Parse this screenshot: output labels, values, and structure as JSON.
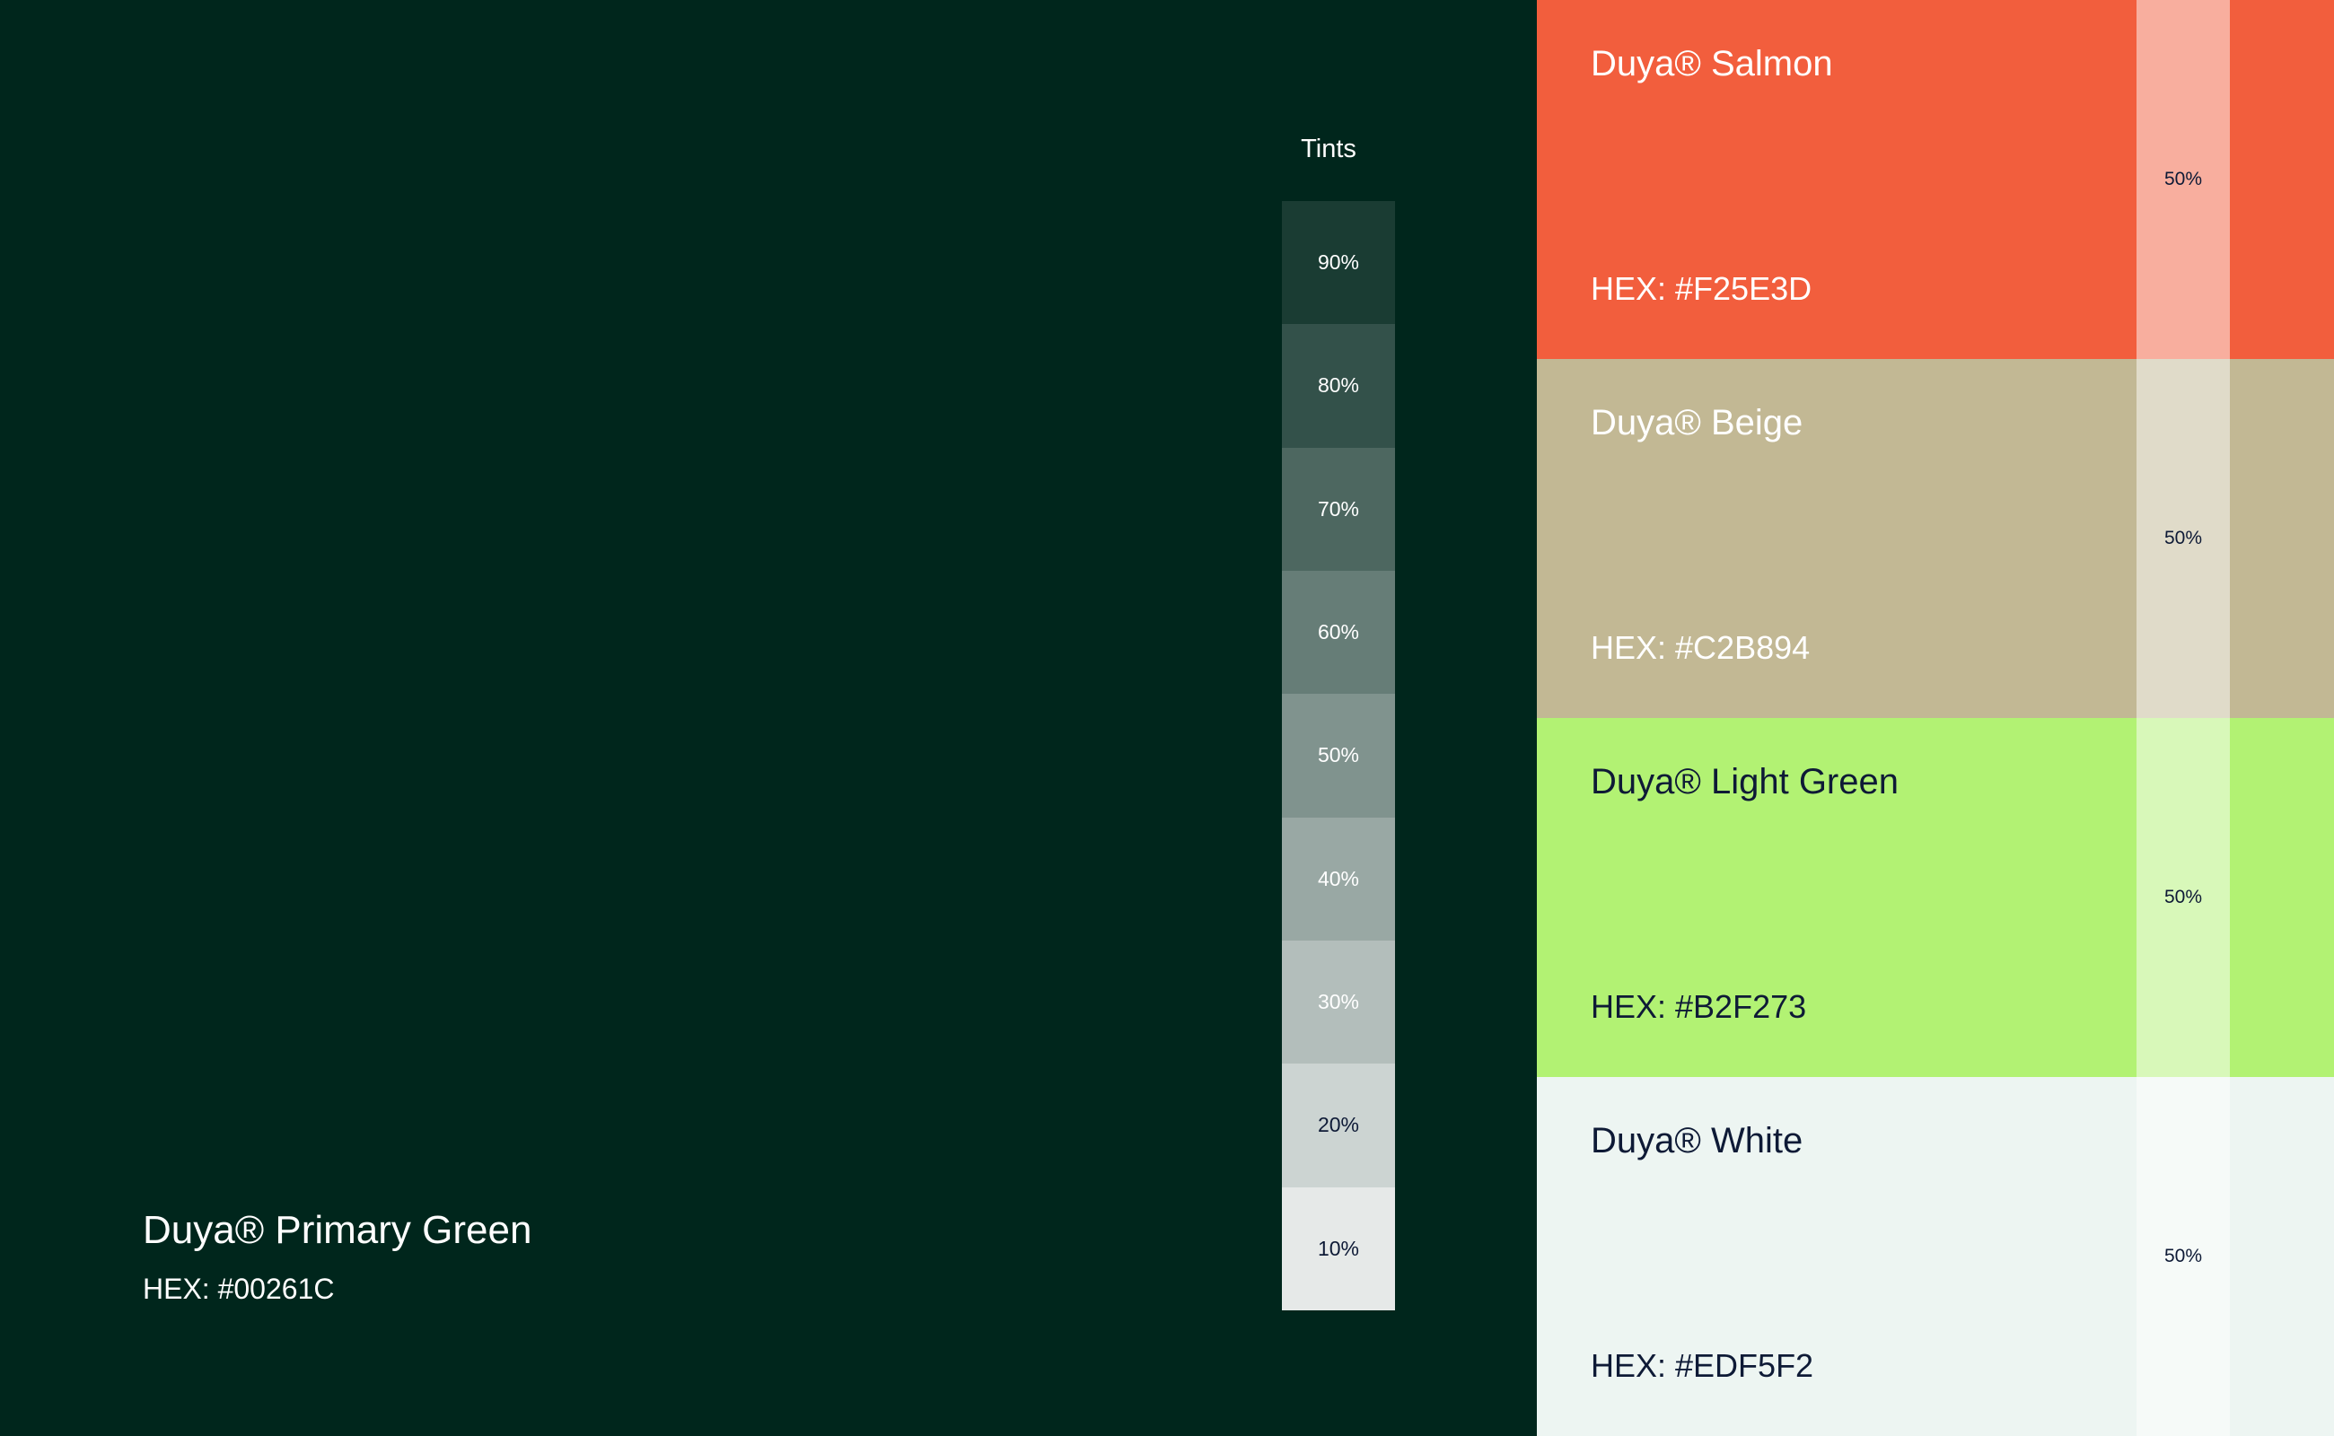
{
  "primary": {
    "name": "Duya® Primary Green",
    "hex_label": "HEX: #00261C",
    "color": "#00261C"
  },
  "tints": {
    "label": "Tints",
    "swatches": [
      {
        "label": "90%",
        "color": "#1A3C33",
        "text_color": "#FFFFFF"
      },
      {
        "label": "80%",
        "color": "#33514A",
        "text_color": "#FFFFFF"
      },
      {
        "label": "70%",
        "color": "#4D6760",
        "text_color": "#FFFFFF"
      },
      {
        "label": "60%",
        "color": "#667D77",
        "text_color": "#FFFFFF"
      },
      {
        "label": "50%",
        "color": "#80938E",
        "text_color": "#FFFFFF"
      },
      {
        "label": "40%",
        "color": "#99A8A4",
        "text_color": "#FFFFFF"
      },
      {
        "label": "30%",
        "color": "#B3BEBB",
        "text_color": "#FFFFFF"
      },
      {
        "label": "20%",
        "color": "#CCD4D2",
        "text_color": "#0E1A36"
      },
      {
        "label": "10%",
        "color": "#E6E9E8",
        "text_color": "#0E1A36"
      }
    ]
  },
  "accents": [
    {
      "name": "Duya® Salmon",
      "hex_label": "HEX: #F25E3D",
      "color": "#F25E3D",
      "tint_label": "50%",
      "tint_color": "#F8AE9E",
      "text_color": "#FFFFFF",
      "tint_text_color": "#0E1A36"
    },
    {
      "name": "Duya® Beige",
      "hex_label": "HEX: #C2B894",
      "color": "#C2B894",
      "tint_label": "50%",
      "tint_color": "#E0DBC9",
      "text_color": "#FFFFFF",
      "tint_text_color": "#0E1A36"
    },
    {
      "name": "Duya® Light Green",
      "hex_label": "HEX: #B2F273",
      "color": "#B2F273",
      "tint_label": "50%",
      "tint_color": "#D8F8B9",
      "text_color": "#0E1A36",
      "tint_text_color": "#0E1A36"
    },
    {
      "name": "Duya® White",
      "hex_label": "HEX: #EDF5F2",
      "color": "#EDF5F2",
      "tint_label": "50%",
      "tint_color": "#F6FAF8",
      "text_color": "#0E1A36",
      "tint_text_color": "#0E1A36"
    }
  ]
}
